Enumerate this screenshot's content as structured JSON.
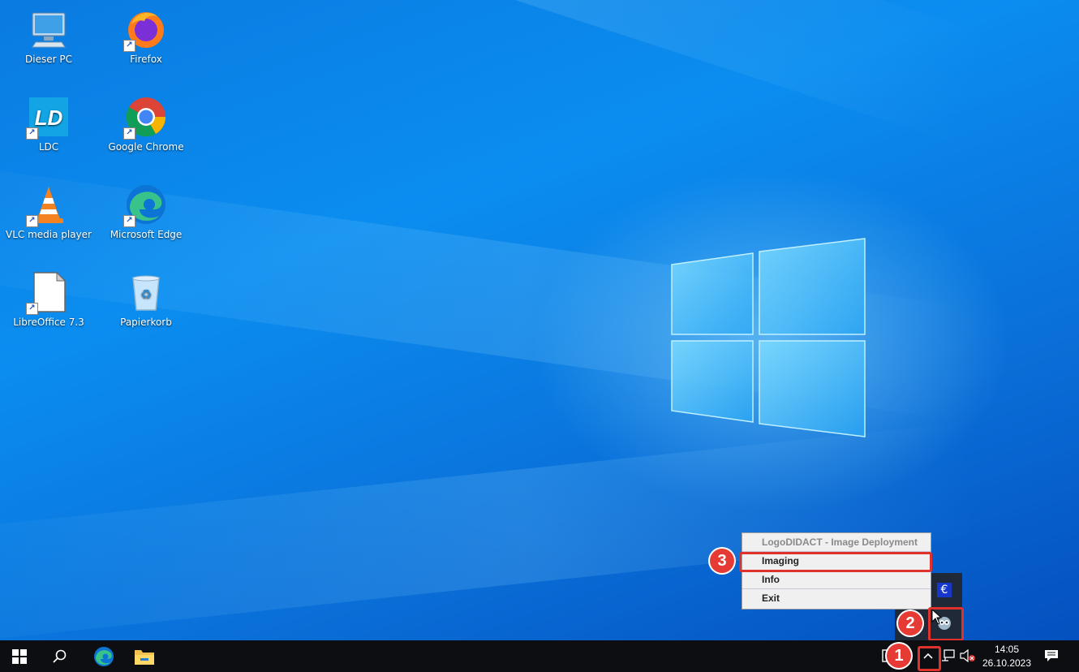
{
  "desktop": {
    "icons": [
      {
        "label": "Dieser PC"
      },
      {
        "label": "Firefox"
      },
      {
        "label": "LDC"
      },
      {
        "label": "Google Chrome"
      },
      {
        "label": "VLC media player"
      },
      {
        "label": "Microsoft Edge"
      },
      {
        "label": "LibreOffice 7.3"
      },
      {
        "label": "Papierkorb"
      }
    ],
    "ldc_logo_text": "LD"
  },
  "context_menu": {
    "header": "LogoDIDACT - Image Deployment",
    "items": [
      {
        "label": "Imaging"
      },
      {
        "label": "Info"
      },
      {
        "label": "Exit"
      }
    ]
  },
  "tray_overflow": {
    "euro_icon": "€"
  },
  "annotations": {
    "badge_1": "1",
    "badge_2": "2",
    "badge_3": "3"
  },
  "taskbar": {
    "clock": {
      "time": "14:05",
      "date": "26.10.2023"
    }
  },
  "colors": {
    "highlight": "#e0322c",
    "taskbar_bg": "#0d0e12",
    "desktop_blue": "#0a7be0"
  }
}
